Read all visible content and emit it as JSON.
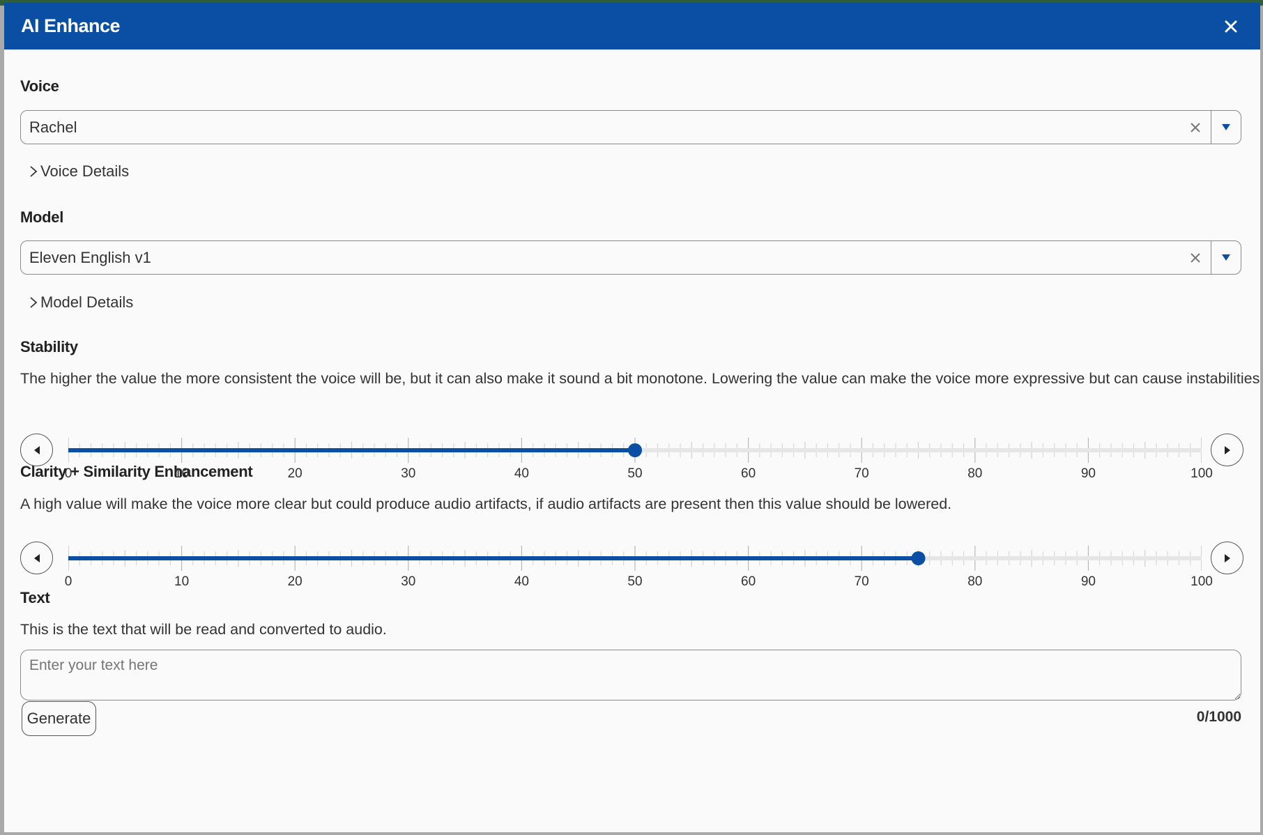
{
  "dialog": {
    "title": "AI Enhance"
  },
  "voice": {
    "label": "Voice",
    "selected": "Rachel",
    "details_label": "Voice Details"
  },
  "model": {
    "label": "Model",
    "selected": "Eleven English v1",
    "details_label": "Model Details"
  },
  "stability": {
    "label": "Stability",
    "description": "The higher the value the more consistent the voice will be, but it can also make it sound a bit monotone. Lowering the value can make the voice more expressive but can cause instabilities.",
    "value": 50,
    "min": 0,
    "max": 100,
    "tick_labels": [
      "0",
      "10",
      "20",
      "30",
      "40",
      "50",
      "60",
      "70",
      "80",
      "90",
      "100"
    ]
  },
  "clarity": {
    "label": "Clarity + Similarity Enhancement",
    "description": "A high value will make the voice more clear but could produce audio artifacts, if audio artifacts are present then this value should be lowered.",
    "value": 75,
    "min": 0,
    "max": 100,
    "tick_labels": [
      "0",
      "10",
      "20",
      "30",
      "40",
      "50",
      "60",
      "70",
      "80",
      "90",
      "100"
    ]
  },
  "text": {
    "label": "Text",
    "description": "This is the text that will be read and converted to audio.",
    "placeholder": "Enter your text here",
    "counter": "0/1000"
  },
  "actions": {
    "generate_label": "Generate"
  },
  "colors": {
    "accent": "#0a4fa3",
    "track": "#e6e6e6"
  }
}
